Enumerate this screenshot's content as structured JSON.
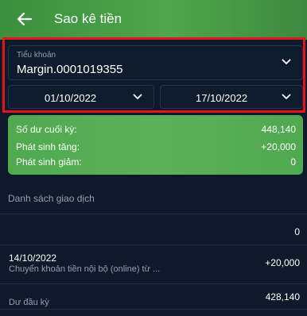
{
  "header": {
    "title": "Sao kê tiền",
    "back_icon": "arrow-left-icon"
  },
  "account": {
    "label": "Tiểu khoản",
    "value": "Margin.0001019355"
  },
  "dates": {
    "from": "01/10/2022",
    "to": "17/10/2022"
  },
  "summary": {
    "closing_label": "Số dư cuối kỳ:",
    "closing_value": "448,140",
    "increase_label": "Phát sinh tăng:",
    "increase_value": "+20,000",
    "decrease_label": "Phát sinh giảm:",
    "decrease_value": "0"
  },
  "list": {
    "title": "Danh sách giao dịch",
    "top_value": "0",
    "transaction": {
      "date": "14/10/2022",
      "description": "Chuyển khoản tiền nội bộ (online) từ ...",
      "amount": "+20,000"
    },
    "opening_label": "Dư đầu kỳ",
    "opening_value": "428,140"
  },
  "colors": {
    "header_green": "#4fa64c",
    "summary_green": "#56ad53",
    "background": "#0e1a2b",
    "highlight_red": "#e3141b"
  }
}
